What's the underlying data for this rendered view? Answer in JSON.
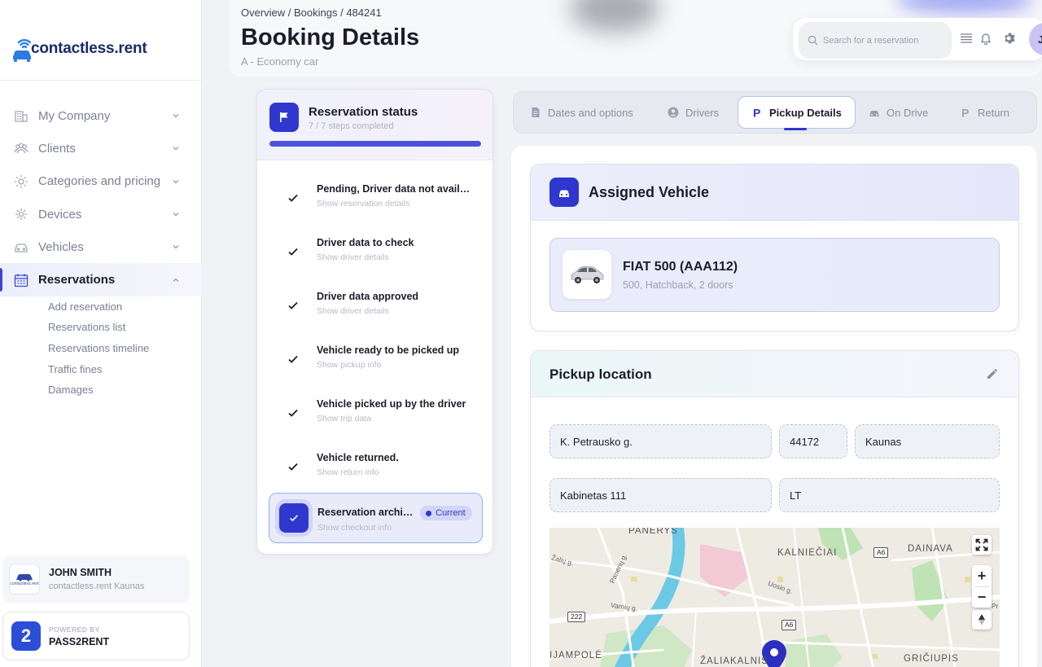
{
  "brand": {
    "name": "contactless.rent"
  },
  "sidebar": {
    "items": [
      {
        "label": "My Company",
        "icon": "building-icon"
      },
      {
        "label": "Clients",
        "icon": "users-icon"
      },
      {
        "label": "Categories and pricing",
        "icon": "tag-gear-icon"
      },
      {
        "label": "Devices",
        "icon": "device-icon"
      },
      {
        "label": "Vehicles",
        "icon": "car-icon"
      },
      {
        "label": "Reservations",
        "icon": "calendar-icon"
      }
    ],
    "sub_items": [
      "Add reservation",
      "Reservations list",
      "Reservations timeline",
      "Traffic fines",
      "Damages"
    ]
  },
  "user": {
    "name": "JOHN SMITH",
    "company": "contactless.rent Kaunas",
    "logo_text": "contactless.rent"
  },
  "powered": {
    "label": "POWERED BY",
    "name": "PASS2RENT",
    "logo_char": "2"
  },
  "header": {
    "breadcrumb": "Overview / Bookings / 484241",
    "title": "Booking Details",
    "subtitle": "A - Economy car",
    "search_placeholder": "Search for a reservation",
    "avatar_initial": "J"
  },
  "status": {
    "title": "Reservation status",
    "steps_text": "7 / 7 steps completed",
    "progress": 1.0,
    "steps": [
      {
        "title": "Pending, Driver data not available",
        "link": "Show reservation details"
      },
      {
        "title": "Driver data to check",
        "link": "Show driver details"
      },
      {
        "title": "Driver data approved",
        "link": "Show driver details"
      },
      {
        "title": "Vehicle ready to be picked up",
        "link": "Show pickup info"
      },
      {
        "title": "Vehicle picked up by the driver",
        "link": "Show trip data"
      },
      {
        "title": "Vehicle returned.",
        "link": "Show return info"
      }
    ],
    "current": {
      "title": "Reservation archived",
      "link": "Show checkout info",
      "badge": "Current"
    }
  },
  "tabs": [
    {
      "label": "Dates and options",
      "icon": "document-icon"
    },
    {
      "label": "Drivers",
      "icon": "user-circle-icon"
    },
    {
      "label": "Pickup Details",
      "icon": "parking-icon",
      "active": true
    },
    {
      "label": "On Drive",
      "icon": "car-icon"
    },
    {
      "label": "Return",
      "icon": "parking-icon"
    }
  ],
  "vehicle": {
    "section_title": "Assigned Vehicle",
    "name": "FIAT 500 (AAA112)",
    "details": "500, Hatchback, 2 doors"
  },
  "pickup": {
    "section_title": "Pickup location",
    "street": "K. Petrausko g.",
    "postcode": "44172",
    "city": "Kaunas",
    "address2": "Kabinetas 111",
    "country": "LT"
  },
  "map": {
    "labels": [
      "PANERYS",
      "KALNIEČIAI",
      "DAINAVA",
      "IJAMPOLĖ",
      "ŽALIAKALNIS",
      "GRIČIUPIS"
    ],
    "streets": [
      "Žalių g.",
      "Panerių g.",
      "Varnių g.",
      "Uosio g.",
      "Pr"
    ],
    "roads": [
      "A6",
      "222",
      "A6"
    ],
    "zoom_in": "+",
    "zoom_out": "−"
  },
  "colors": {
    "accent": "#2f37cf",
    "progress": "#4c52dc"
  }
}
